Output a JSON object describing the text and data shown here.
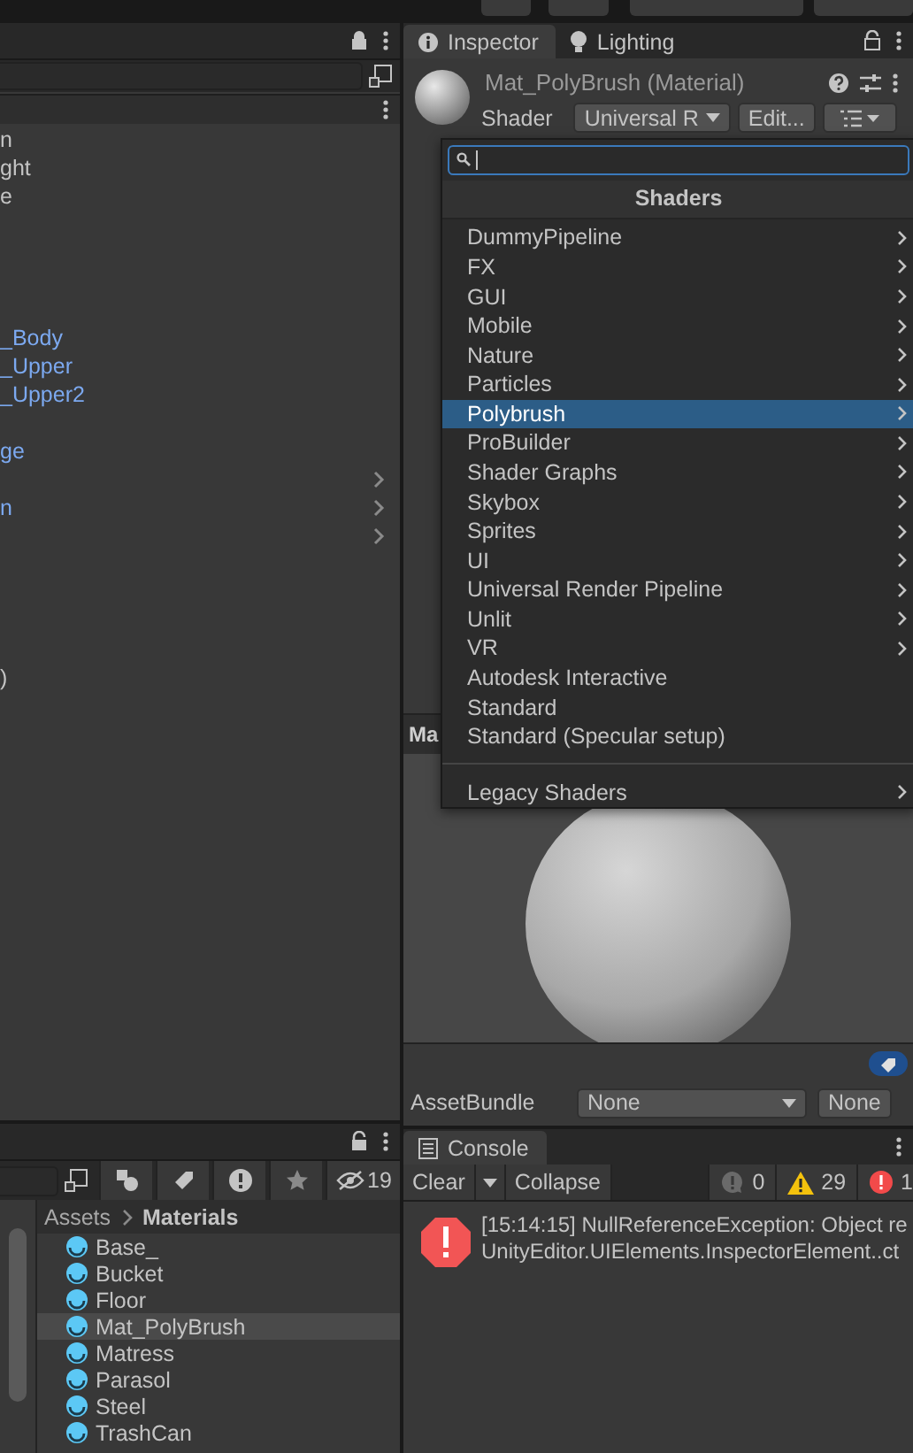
{
  "hierarchy": {
    "rows": [
      {
        "label": "n",
        "prefab": false,
        "expandable": false
      },
      {
        "label": "ght",
        "prefab": false,
        "expandable": false
      },
      {
        "label": "e",
        "prefab": false,
        "expandable": false
      },
      {
        "expandable": false
      },
      {
        "expandable": false
      },
      {
        "expandable": false
      },
      {
        "expandable": false
      },
      {
        "label": "_Body",
        "prefab": true,
        "expandable": false
      },
      {
        "label": "_Upper",
        "prefab": true,
        "expandable": false
      },
      {
        "label": "_Upper2",
        "prefab": true,
        "expandable": false
      },
      {
        "expandable": false
      },
      {
        "label": "ge",
        "prefab": true,
        "expandable": false
      },
      {
        "expandable": true
      },
      {
        "label": "n",
        "prefab": true,
        "expandable": true
      },
      {
        "expandable": true
      },
      {
        "expandable": false
      },
      {
        "expandable": false
      },
      {
        "expandable": false
      },
      {
        "expandable": false
      },
      {
        "label": ")",
        "prefab": false,
        "expandable": false
      }
    ]
  },
  "inspector": {
    "tabs": [
      {
        "label": "Inspector",
        "selected": true
      },
      {
        "label": "Lighting",
        "selected": false
      }
    ],
    "title": "Mat_PolyBrush (Material)",
    "shader_label": "Shader",
    "shader_value": "Universal R",
    "edit_button": "Edit...",
    "preview_label": "Ma",
    "asset_bundle_label": "AssetBundle",
    "asset_bundle": "None",
    "variant": "None"
  },
  "shader_menu": {
    "header": "Shaders",
    "items": [
      {
        "kind": "item",
        "label": "DummyPipeline",
        "submenu": true,
        "selected": false
      },
      {
        "kind": "item",
        "label": "FX",
        "submenu": true,
        "selected": false
      },
      {
        "kind": "item",
        "label": "GUI",
        "submenu": true,
        "selected": false
      },
      {
        "kind": "item",
        "label": "Mobile",
        "submenu": true,
        "selected": false
      },
      {
        "kind": "item",
        "label": "Nature",
        "submenu": true,
        "selected": false
      },
      {
        "kind": "item",
        "label": "Particles",
        "submenu": true,
        "selected": false
      },
      {
        "kind": "item",
        "label": "Polybrush",
        "submenu": true,
        "selected": true
      },
      {
        "kind": "item",
        "label": "ProBuilder",
        "submenu": true,
        "selected": false
      },
      {
        "kind": "item",
        "label": "Shader Graphs",
        "submenu": true,
        "selected": false
      },
      {
        "kind": "item",
        "label": "Skybox",
        "submenu": true,
        "selected": false
      },
      {
        "kind": "item",
        "label": "Sprites",
        "submenu": true,
        "selected": false
      },
      {
        "kind": "item",
        "label": "UI",
        "submenu": true,
        "selected": false
      },
      {
        "kind": "item",
        "label": "Universal Render Pipeline",
        "submenu": true,
        "selected": false
      },
      {
        "kind": "item",
        "label": "Unlit",
        "submenu": true,
        "selected": false
      },
      {
        "kind": "item",
        "label": "VR",
        "submenu": true,
        "selected": false
      },
      {
        "kind": "item",
        "label": "Autodesk Interactive",
        "submenu": false,
        "selected": false
      },
      {
        "kind": "item",
        "label": "Standard",
        "submenu": false,
        "selected": false
      },
      {
        "kind": "item",
        "label": "Standard (Specular setup)",
        "submenu": false,
        "selected": false
      },
      {
        "kind": "separator"
      },
      {
        "kind": "item",
        "label": "Legacy Shaders",
        "submenu": true,
        "selected": false
      }
    ]
  },
  "project": {
    "hidden_count": "19",
    "breadcrumb": [
      "Assets",
      "Materials"
    ],
    "files": [
      {
        "label": "Base_",
        "selected": false
      },
      {
        "label": "Bucket",
        "selected": false
      },
      {
        "label": "Floor",
        "selected": false
      },
      {
        "label": "Mat_PolyBrush",
        "selected": true
      },
      {
        "label": "Matress",
        "selected": false
      },
      {
        "label": "Parasol",
        "selected": false
      },
      {
        "label": "Steel",
        "selected": false
      },
      {
        "label": "TrashCan",
        "selected": false
      }
    ]
  },
  "console": {
    "tab": "Console",
    "clear": "Clear",
    "collapse": "Collapse",
    "info_count": "0",
    "warning_count": "29",
    "error_count": "1",
    "entries": [
      {
        "lines": [
          "[15:14:15] NullReferenceException: Object re",
          "UnityEditor.UIElements.InspectorElement..ct"
        ]
      }
    ]
  }
}
